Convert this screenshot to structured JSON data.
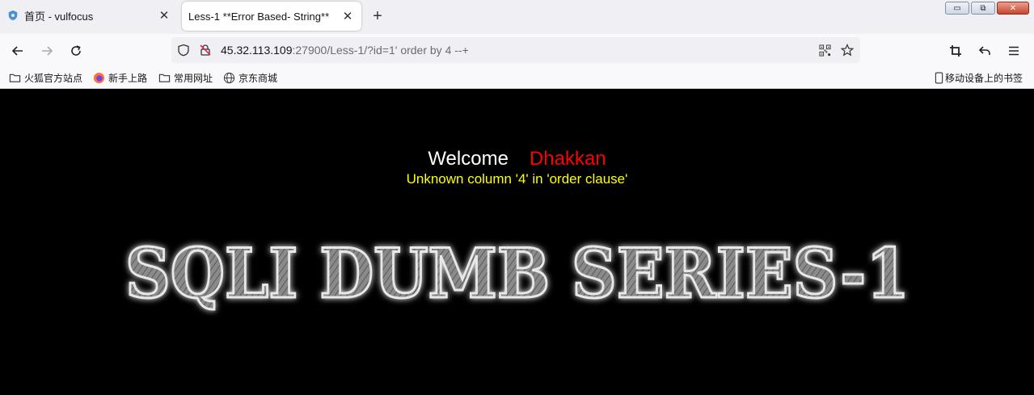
{
  "tabs": [
    {
      "title": "首页 - vulfocus",
      "icon": "shield-icon",
      "active": false
    },
    {
      "title": "Less-1 **Error Based- String**",
      "icon": "",
      "active": true
    }
  ],
  "window_controls": {
    "minimize": "▭",
    "restore": "⧉",
    "close": "✕"
  },
  "navbar": {
    "url_host": "45.32.113.109",
    "url_rest": ":27900/Less-1/?id=1' order by 4 --+"
  },
  "bookmarks": [
    {
      "label": "火狐官方站点",
      "icon": "folder-icon"
    },
    {
      "label": "新手上路",
      "icon": "firefox-icon"
    },
    {
      "label": "常用网址",
      "icon": "folder-icon"
    },
    {
      "label": "京东商城",
      "icon": "globe-icon"
    }
  ],
  "mobile_bookmarks": "移动设备上的书签",
  "page": {
    "welcome": "Welcome",
    "username": "Dhakkan",
    "error": "Unknown column '4' in 'order clause'",
    "banner_text": "SQLI DUMB SERIES-1"
  },
  "colors": {
    "page_bg": "#000000",
    "welcome": "#ffffff",
    "username": "#ff0000",
    "error": "#ffff00"
  }
}
